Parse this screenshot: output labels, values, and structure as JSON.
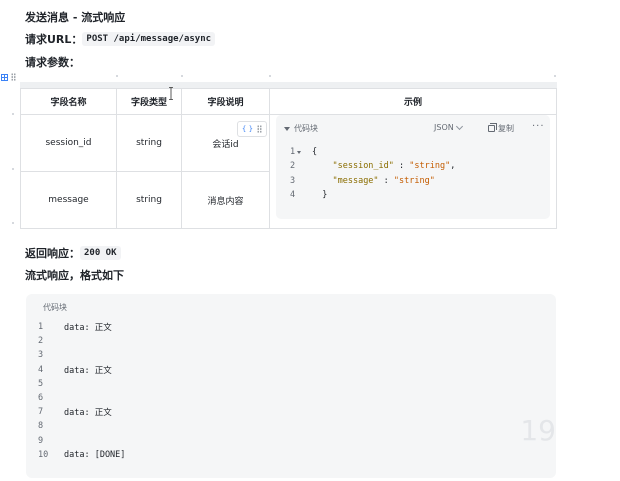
{
  "doc": {
    "title": "发送消息 - 流式响应",
    "url_label": "请求URL：",
    "url_value": "POST /api/message/async",
    "params_label": "请求参数：",
    "response_label": "返回响应：",
    "response_value": "200 OK",
    "stream_label": "流式响应，格式如下"
  },
  "table": {
    "headers": [
      "字段名称",
      "字段类型",
      "字段说明",
      "示例"
    ],
    "rows": [
      {
        "name": "session_id",
        "type": "string",
        "desc": "会话id"
      },
      {
        "name": "message",
        "type": "string",
        "desc": "消息内容"
      }
    ],
    "cell_tool": {
      "label": "{ }",
      "icon": "drag-dots-icon"
    }
  },
  "embedded_code": {
    "title": "代码块",
    "language": "JSON",
    "copy_label": "复制",
    "more": "···",
    "line_numbers": [
      "1",
      "2",
      "3",
      "4"
    ],
    "lines": {
      "l1": "{",
      "l2_key": "\"session_id\"",
      "l2_sep": " : ",
      "l2_val": "\"string\"",
      "l2_end": ",",
      "l3_key": "\"message\"",
      "l3_sep": " : ",
      "l3_val": "\"string\"",
      "l4": "}"
    }
  },
  "stream_code": {
    "title": "代码块",
    "line_numbers": [
      "1",
      "2",
      "3",
      "4",
      "5",
      "6",
      "7",
      "8",
      "9",
      "10"
    ],
    "lines": [
      "data: 正文",
      "",
      "",
      "data: 正文",
      "",
      "",
      "data: 正文",
      "",
      "",
      "data: [DONE]"
    ],
    "watermark": "19"
  },
  "colors": {
    "accent": "#3b82f6",
    "code_bg": "#f5f6f7",
    "string": "#c45c00"
  }
}
